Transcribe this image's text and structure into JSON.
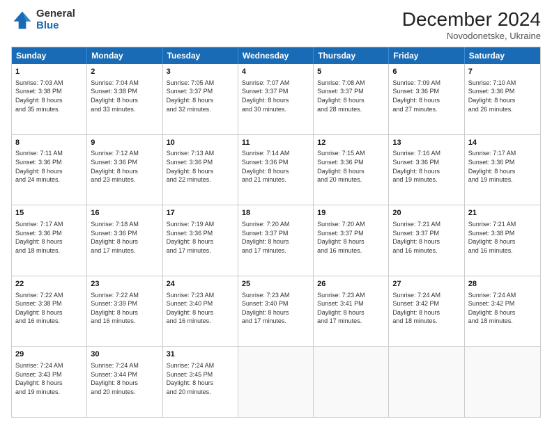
{
  "header": {
    "logo_general": "General",
    "logo_blue": "Blue",
    "month_title": "December 2024",
    "location": "Novodonetske, Ukraine"
  },
  "days_of_week": [
    "Sunday",
    "Monday",
    "Tuesday",
    "Wednesday",
    "Thursday",
    "Friday",
    "Saturday"
  ],
  "weeks": [
    [
      {
        "day": "1",
        "lines": [
          "Sunrise: 7:03 AM",
          "Sunset: 3:38 PM",
          "Daylight: 8 hours",
          "and 35 minutes."
        ]
      },
      {
        "day": "2",
        "lines": [
          "Sunrise: 7:04 AM",
          "Sunset: 3:38 PM",
          "Daylight: 8 hours",
          "and 33 minutes."
        ]
      },
      {
        "day": "3",
        "lines": [
          "Sunrise: 7:05 AM",
          "Sunset: 3:37 PM",
          "Daylight: 8 hours",
          "and 32 minutes."
        ]
      },
      {
        "day": "4",
        "lines": [
          "Sunrise: 7:07 AM",
          "Sunset: 3:37 PM",
          "Daylight: 8 hours",
          "and 30 minutes."
        ]
      },
      {
        "day": "5",
        "lines": [
          "Sunrise: 7:08 AM",
          "Sunset: 3:37 PM",
          "Daylight: 8 hours",
          "and 28 minutes."
        ]
      },
      {
        "day": "6",
        "lines": [
          "Sunrise: 7:09 AM",
          "Sunset: 3:36 PM",
          "Daylight: 8 hours",
          "and 27 minutes."
        ]
      },
      {
        "day": "7",
        "lines": [
          "Sunrise: 7:10 AM",
          "Sunset: 3:36 PM",
          "Daylight: 8 hours",
          "and 26 minutes."
        ]
      }
    ],
    [
      {
        "day": "8",
        "lines": [
          "Sunrise: 7:11 AM",
          "Sunset: 3:36 PM",
          "Daylight: 8 hours",
          "and 24 minutes."
        ]
      },
      {
        "day": "9",
        "lines": [
          "Sunrise: 7:12 AM",
          "Sunset: 3:36 PM",
          "Daylight: 8 hours",
          "and 23 minutes."
        ]
      },
      {
        "day": "10",
        "lines": [
          "Sunrise: 7:13 AM",
          "Sunset: 3:36 PM",
          "Daylight: 8 hours",
          "and 22 minutes."
        ]
      },
      {
        "day": "11",
        "lines": [
          "Sunrise: 7:14 AM",
          "Sunset: 3:36 PM",
          "Daylight: 8 hours",
          "and 21 minutes."
        ]
      },
      {
        "day": "12",
        "lines": [
          "Sunrise: 7:15 AM",
          "Sunset: 3:36 PM",
          "Daylight: 8 hours",
          "and 20 minutes."
        ]
      },
      {
        "day": "13",
        "lines": [
          "Sunrise: 7:16 AM",
          "Sunset: 3:36 PM",
          "Daylight: 8 hours",
          "and 19 minutes."
        ]
      },
      {
        "day": "14",
        "lines": [
          "Sunrise: 7:17 AM",
          "Sunset: 3:36 PM",
          "Daylight: 8 hours",
          "and 19 minutes."
        ]
      }
    ],
    [
      {
        "day": "15",
        "lines": [
          "Sunrise: 7:17 AM",
          "Sunset: 3:36 PM",
          "Daylight: 8 hours",
          "and 18 minutes."
        ]
      },
      {
        "day": "16",
        "lines": [
          "Sunrise: 7:18 AM",
          "Sunset: 3:36 PM",
          "Daylight: 8 hours",
          "and 17 minutes."
        ]
      },
      {
        "day": "17",
        "lines": [
          "Sunrise: 7:19 AM",
          "Sunset: 3:36 PM",
          "Daylight: 8 hours",
          "and 17 minutes."
        ]
      },
      {
        "day": "18",
        "lines": [
          "Sunrise: 7:20 AM",
          "Sunset: 3:37 PM",
          "Daylight: 8 hours",
          "and 17 minutes."
        ]
      },
      {
        "day": "19",
        "lines": [
          "Sunrise: 7:20 AM",
          "Sunset: 3:37 PM",
          "Daylight: 8 hours",
          "and 16 minutes."
        ]
      },
      {
        "day": "20",
        "lines": [
          "Sunrise: 7:21 AM",
          "Sunset: 3:37 PM",
          "Daylight: 8 hours",
          "and 16 minutes."
        ]
      },
      {
        "day": "21",
        "lines": [
          "Sunrise: 7:21 AM",
          "Sunset: 3:38 PM",
          "Daylight: 8 hours",
          "and 16 minutes."
        ]
      }
    ],
    [
      {
        "day": "22",
        "lines": [
          "Sunrise: 7:22 AM",
          "Sunset: 3:38 PM",
          "Daylight: 8 hours",
          "and 16 minutes."
        ]
      },
      {
        "day": "23",
        "lines": [
          "Sunrise: 7:22 AM",
          "Sunset: 3:39 PM",
          "Daylight: 8 hours",
          "and 16 minutes."
        ]
      },
      {
        "day": "24",
        "lines": [
          "Sunrise: 7:23 AM",
          "Sunset: 3:40 PM",
          "Daylight: 8 hours",
          "and 16 minutes."
        ]
      },
      {
        "day": "25",
        "lines": [
          "Sunrise: 7:23 AM",
          "Sunset: 3:40 PM",
          "Daylight: 8 hours",
          "and 17 minutes."
        ]
      },
      {
        "day": "26",
        "lines": [
          "Sunrise: 7:23 AM",
          "Sunset: 3:41 PM",
          "Daylight: 8 hours",
          "and 17 minutes."
        ]
      },
      {
        "day": "27",
        "lines": [
          "Sunrise: 7:24 AM",
          "Sunset: 3:42 PM",
          "Daylight: 8 hours",
          "and 18 minutes."
        ]
      },
      {
        "day": "28",
        "lines": [
          "Sunrise: 7:24 AM",
          "Sunset: 3:42 PM",
          "Daylight: 8 hours",
          "and 18 minutes."
        ]
      }
    ],
    [
      {
        "day": "29",
        "lines": [
          "Sunrise: 7:24 AM",
          "Sunset: 3:43 PM",
          "Daylight: 8 hours",
          "and 19 minutes."
        ]
      },
      {
        "day": "30",
        "lines": [
          "Sunrise: 7:24 AM",
          "Sunset: 3:44 PM",
          "Daylight: 8 hours",
          "and 20 minutes."
        ]
      },
      {
        "day": "31",
        "lines": [
          "Sunrise: 7:24 AM",
          "Sunset: 3:45 PM",
          "Daylight: 8 hours",
          "and 20 minutes."
        ]
      },
      {
        "day": "",
        "lines": []
      },
      {
        "day": "",
        "lines": []
      },
      {
        "day": "",
        "lines": []
      },
      {
        "day": "",
        "lines": []
      }
    ]
  ]
}
